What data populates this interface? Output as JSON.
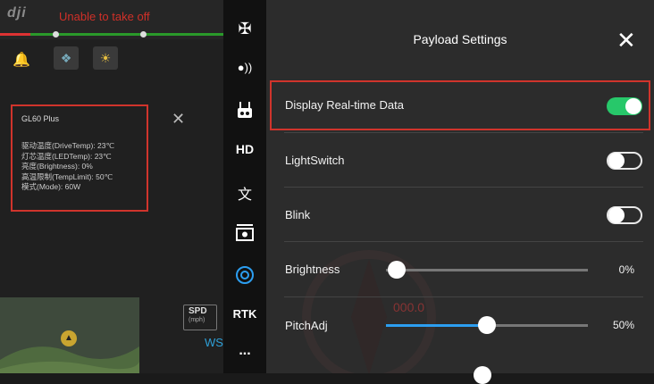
{
  "left_panel": {
    "logo": "dji",
    "status": "Unable to take off",
    "gl60": {
      "title": "GL60 Plus",
      "lines": [
        "驱动温度(DriveTemp): 23℃",
        "灯芯温度(LEDTemp): 23℃",
        "亮度(Brightness): 0%",
        "高温限制(TempLimit): 50℃",
        "模式(Mode): 60W"
      ],
      "close_icon": "close-icon"
    },
    "speed": {
      "label": "SPD",
      "unit": "(mph)"
    },
    "ws": "WS"
  },
  "icon_column": {
    "items": [
      {
        "icon": "drone-icon",
        "text": ""
      },
      {
        "icon": "signal-icon",
        "text": ""
      },
      {
        "icon": "controller-icon",
        "text": ""
      },
      {
        "icon": "hd-icon",
        "text": "HD"
      },
      {
        "icon": "language-icon",
        "text": ""
      },
      {
        "icon": "camera-icon",
        "text": ""
      },
      {
        "icon": "payload-gear-icon",
        "text": ""
      },
      {
        "icon": "rtk-icon",
        "text": "RTK"
      },
      {
        "icon": "more-icon",
        "text": "..."
      }
    ]
  },
  "payload_settings": {
    "title": "Payload Settings",
    "rows": [
      {
        "label": "Display Real-time Data",
        "type": "toggle",
        "on": true
      },
      {
        "label": "LightSwitch",
        "type": "toggle",
        "on": false
      },
      {
        "label": "Blink",
        "type": "toggle",
        "on": false
      },
      {
        "label": "Brightness",
        "type": "slider",
        "value": "0%",
        "fraction": 0.0
      },
      {
        "label": "PitchAdj",
        "type": "slider",
        "value": "50%",
        "fraction": 0.5
      }
    ]
  },
  "colors": {
    "accent_green": "#27c86a",
    "highlight_red": "#d0342c",
    "slider_blue": "#2c9ef0"
  }
}
